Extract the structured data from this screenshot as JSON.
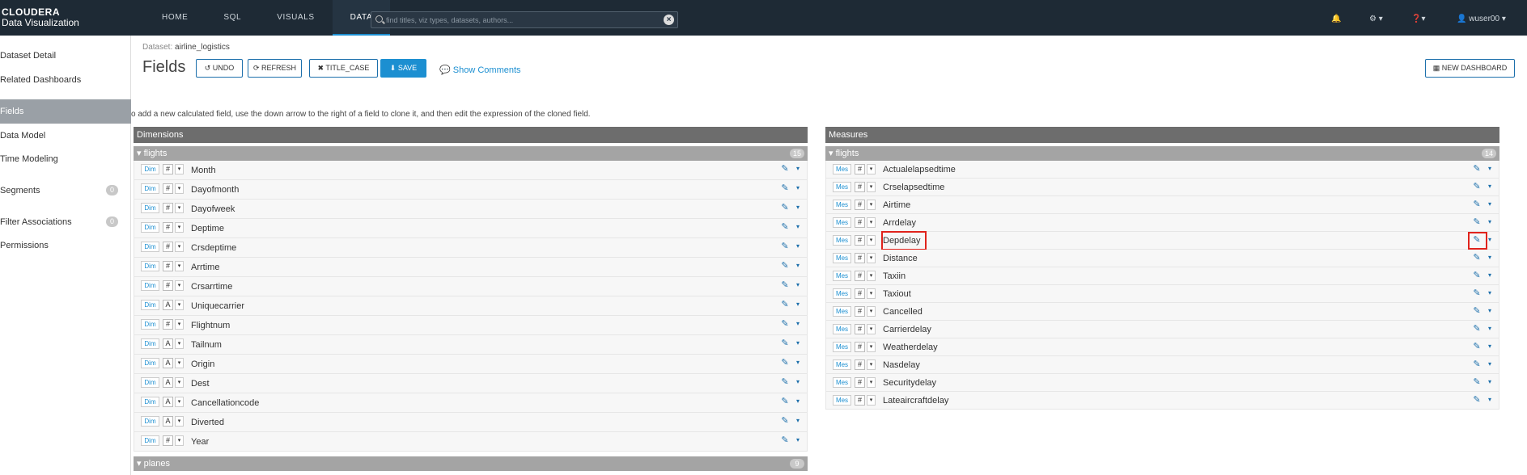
{
  "nav": {
    "brand_line1": "CLOUDERA",
    "brand_line2": "Data Visualization",
    "links": [
      "HOME",
      "SQL",
      "VISUALS",
      "DATA"
    ],
    "active": "DATA",
    "search_placeholder": "find titles, viz types, datasets, authors...",
    "user": "wuser00"
  },
  "sidebar": {
    "items": [
      {
        "label": "Dataset Detail"
      },
      {
        "label": "Related Dashboards"
      },
      {
        "label": "Fields"
      },
      {
        "label": "Data Model"
      },
      {
        "label": "Time Modeling"
      },
      {
        "label": "Segments",
        "badge": "0"
      },
      {
        "label": "Filter Associations",
        "badge": "0"
      },
      {
        "label": "Permissions"
      }
    ],
    "active": "Fields"
  },
  "header": {
    "dataset_prefix": "Dataset:",
    "dataset_name": "airline_logistics",
    "title": "Fields",
    "buttons": {
      "undo": "UNDO",
      "refresh": "REFRESH",
      "title_case": "TITLE_CASE",
      "save": "SAVE"
    },
    "show_comments": "Show Comments",
    "new_dashboard": "NEW DASHBOARD"
  },
  "instruction": "o add a new calculated field, use the down arrow to the right of a field to clone it, and then edit the expression of the cloned field.",
  "dimensions": {
    "title": "Dimensions",
    "groups": [
      {
        "name": "flights",
        "count": "15",
        "fields": [
          {
            "tag": "Dim",
            "type": "#",
            "name": "Month"
          },
          {
            "tag": "Dim",
            "type": "#",
            "name": "Dayofmonth"
          },
          {
            "tag": "Dim",
            "type": "#",
            "name": "Dayofweek"
          },
          {
            "tag": "Dim",
            "type": "#",
            "name": "Deptime"
          },
          {
            "tag": "Dim",
            "type": "#",
            "name": "Crsdeptime"
          },
          {
            "tag": "Dim",
            "type": "#",
            "name": "Arrtime"
          },
          {
            "tag": "Dim",
            "type": "#",
            "name": "Crsarrtime"
          },
          {
            "tag": "Dim",
            "type": "A",
            "name": "Uniquecarrier"
          },
          {
            "tag": "Dim",
            "type": "#",
            "name": "Flightnum"
          },
          {
            "tag": "Dim",
            "type": "A",
            "name": "Tailnum"
          },
          {
            "tag": "Dim",
            "type": "A",
            "name": "Origin"
          },
          {
            "tag": "Dim",
            "type": "A",
            "name": "Dest"
          },
          {
            "tag": "Dim",
            "type": "A",
            "name": "Cancellationcode"
          },
          {
            "tag": "Dim",
            "type": "A",
            "name": "Diverted"
          },
          {
            "tag": "Dim",
            "type": "#",
            "name": "Year"
          }
        ]
      },
      {
        "name": "planes",
        "count": "9",
        "fields": []
      }
    ]
  },
  "measures": {
    "title": "Measures",
    "groups": [
      {
        "name": "flights",
        "count": "14",
        "fields": [
          {
            "tag": "Mes",
            "type": "#",
            "name": "Actualelapsedtime"
          },
          {
            "tag": "Mes",
            "type": "#",
            "name": "Crselapsedtime"
          },
          {
            "tag": "Mes",
            "type": "#",
            "name": "Airtime"
          },
          {
            "tag": "Mes",
            "type": "#",
            "name": "Arrdelay"
          },
          {
            "tag": "Mes",
            "type": "#",
            "name": "Depdelay"
          },
          {
            "tag": "Mes",
            "type": "#",
            "name": "Distance"
          },
          {
            "tag": "Mes",
            "type": "#",
            "name": "Taxiin"
          },
          {
            "tag": "Mes",
            "type": "#",
            "name": "Taxiout"
          },
          {
            "tag": "Mes",
            "type": "#",
            "name": "Cancelled"
          },
          {
            "tag": "Mes",
            "type": "#",
            "name": "Carrierdelay"
          },
          {
            "tag": "Mes",
            "type": "#",
            "name": "Weatherdelay"
          },
          {
            "tag": "Mes",
            "type": "#",
            "name": "Nasdelay"
          },
          {
            "tag": "Mes",
            "type": "#",
            "name": "Securitydelay"
          },
          {
            "tag": "Mes",
            "type": "#",
            "name": "Lateaircraftdelay"
          }
        ]
      }
    ]
  },
  "colors": {
    "nav_bg": "#1e2a35",
    "accent": "#1c8fd1",
    "highlight": "#e0231c"
  }
}
